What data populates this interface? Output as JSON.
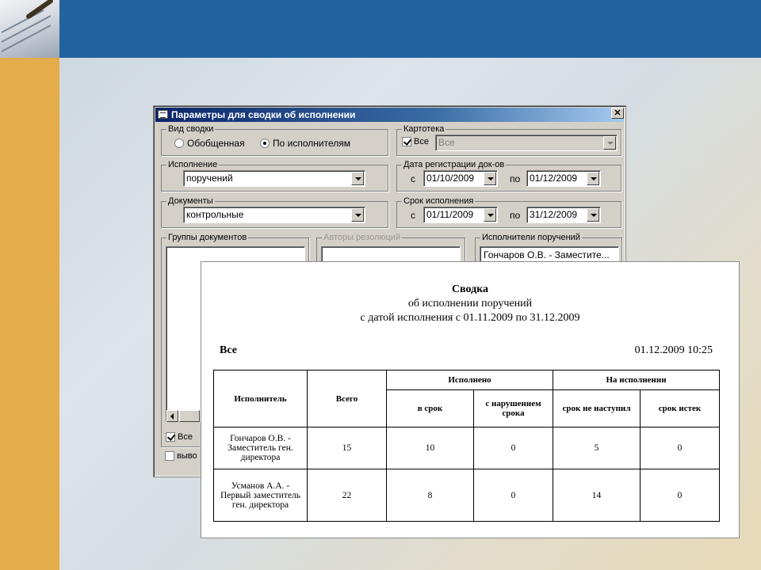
{
  "dialog": {
    "title": "Параметры для сводки об исполнении",
    "close_glyph": "✕",
    "vid_svodki": {
      "label": "Вид сводки",
      "options": [
        "Обобщенная",
        "По исполнителям"
      ],
      "selected_index": 1
    },
    "kartoteka": {
      "label": "Картотека",
      "check_label": "Все",
      "checked": true,
      "value": "Все"
    },
    "ispolnenie": {
      "label": "Исполнение",
      "value": "поручений"
    },
    "data_reg": {
      "label": "Дата регистрации док-ов",
      "from_label": "с",
      "from": "01/10/2009",
      "to_label": "по",
      "to": "01/12/2009"
    },
    "dokumenty": {
      "label": "Документы",
      "value": "контрольные"
    },
    "srok": {
      "label": "Срок исполнения",
      "from_label": "с",
      "from": "01/11/2009",
      "to_label": "по",
      "to": "31/12/2009"
    },
    "gruppy": {
      "label": "Группы документов",
      "check_label": "Все",
      "checked": true
    },
    "avtory": {
      "label": "Авторы резолюций"
    },
    "ispolniteli": {
      "label": "Исполнители поручений",
      "item": "Гончаров О.В. - Заместите..."
    },
    "vyvod": {
      "label": "выво",
      "checked": false
    }
  },
  "report": {
    "title": "Сводка",
    "subtitle1": "об исполнении поручений",
    "subtitle2": "с датой исполнения с 01.11.2009 по 31.12.2009",
    "scope": "Все",
    "datetime": "01.12.2009 10:25",
    "headers": {
      "executor": "Исполнитель",
      "total": "Всего",
      "done": "Исполнено",
      "in_progress": "На исполнении",
      "on_time": "в срок",
      "violated": "с нарушением срока",
      "not_due": "срок не наступил",
      "expired": "срок истек"
    },
    "rows": [
      {
        "name": "Гончаров О.В. - Заместитель ген. директора",
        "total": "15",
        "on_time": "10",
        "violated": "0",
        "not_due": "5",
        "expired": "0"
      },
      {
        "name": "Усманов А.А. - Первый заместитель ген. директора",
        "total": "22",
        "on_time": "8",
        "violated": "0",
        "not_due": "14",
        "expired": "0"
      }
    ]
  },
  "colors": {
    "top_bar": "#22639e",
    "left_bar": "#e5ac4a",
    "window_face": "#d4d0c8",
    "titlebar": "#0a246a"
  }
}
